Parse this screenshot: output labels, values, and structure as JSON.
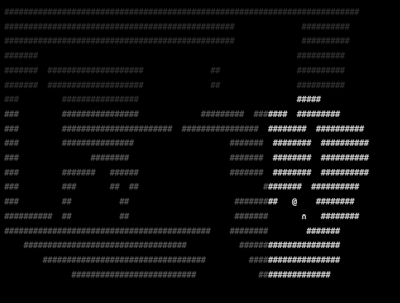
{
  "game": {
    "title": "",
    "glyphs": {
      "wall": "#",
      "player": "@",
      "door": "∩"
    },
    "palette": {
      "background": "#000000",
      "remembered": "#2d2d2d",
      "dim_visible": "#555555",
      "lit": "#d6d6d6",
      "player": "#ffffff"
    },
    "map_rows": [
      {
        "text": "##########################################################################",
        "tone": "dim"
      },
      {
        "text": "################################################              ##########",
        "tone": "dim"
      },
      {
        "text": "################################################              ##########",
        "tone": "dim"
      },
      {
        "text": "#######                                                      ##########",
        "tone": "dim"
      },
      {
        "text": "#######  ####################              ##                ##########",
        "tone": "dim"
      },
      {
        "text": "#######  ####################              ##                ##########",
        "tone": "dim"
      },
      {
        "text": "###         ################                                 #####",
        "tone": "dim"
      },
      {
        "text": "###         ################             #########  #######  #########",
        "tone": "mid"
      },
      {
        "text": "###         #######################  ################  ########  ##########",
        "tone": "mid"
      },
      {
        "text": "###         ###############                    #######  ########  ##########",
        "tone": "mid"
      },
      {
        "text": "###               ########                     #######  ########  ##########",
        "tone": "mid"
      },
      {
        "text": "###         #######   ######                   #######  ########  ##########",
        "tone": "mid"
      },
      {
        "text": "###         ###       ##  ##                          ########  ##########",
        "tone": "mid"
      },
      {
        "text": "###         ##          ##                      #########   @    ########",
        "tone": "mid"
      },
      {
        "text": "##########  ##          ##                      #######       ∩   ########",
        "tone": "mid"
      },
      {
        "text": "###########################################    ########        #######",
        "tone": "mid"
      },
      {
        "text": "    ##################################           #####################",
        "tone": "mid"
      },
      {
        "text": "        ##################################         ###################",
        "tone": "mid"
      },
      {
        "text": "              ##########################             ###############",
        "tone": "mid"
      }
    ]
  }
}
